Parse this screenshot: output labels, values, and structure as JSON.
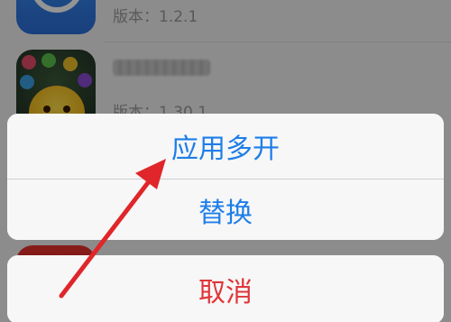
{
  "app_list": {
    "apps": [
      {
        "icon": "app-blue-ab-icon",
        "name": "",
        "version": "版本：1.2.1"
      },
      {
        "icon": "game-chick-icon",
        "name": "",
        "version": "版本：1.30.1"
      },
      {
        "icon": "app-red-icon",
        "name": "",
        "version": ""
      }
    ]
  },
  "action_sheet": {
    "clone_label": "应用多开",
    "replace_label": "替换",
    "cancel_label": "取消"
  },
  "colors": {
    "action_blue": "#1e7ee8",
    "cancel_red": "#e0363a",
    "arrow_red": "#e0262a"
  }
}
